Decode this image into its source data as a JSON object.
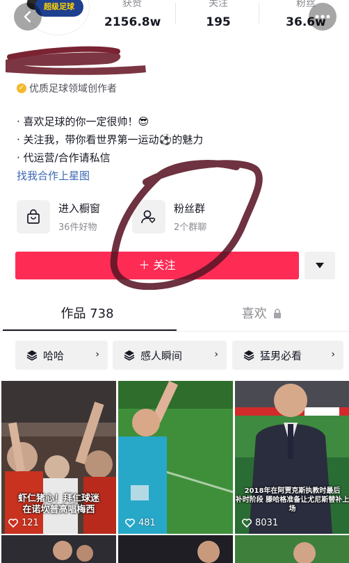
{
  "header": {
    "back_icon": "chevron-left-icon",
    "more_icon": "ellipsis-icon",
    "stats": [
      {
        "label": "获赞",
        "value": "2156.8w"
      },
      {
        "label": "关注",
        "value": "195"
      },
      {
        "label": "粉丝",
        "value": "36.6w"
      }
    ],
    "avatar_badge": "超级足球"
  },
  "profile": {
    "verified_label": "优质足球领域创作者",
    "bio": [
      "· 喜欢足球的你一定很帅！😎",
      "· 关注我，带你看世界第一运动⚽的魅力",
      "· 代运营/合作请私信"
    ],
    "star_link": "找我合作上星图"
  },
  "features": {
    "shop": {
      "title": "进入橱窗",
      "subtitle": "36件好物",
      "icon": "shopping-bag-icon"
    },
    "fans": {
      "title": "粉丝群",
      "subtitle": "2个群聊",
      "icon": "fan-group-icon"
    }
  },
  "actions": {
    "follow_label": "＋ 关注",
    "dropdown_icon": "triangle-down-icon"
  },
  "tabs": [
    {
      "label": "作品 738"
    },
    {
      "label": "喜欢"
    }
  ],
  "collections": [
    {
      "label": "哈哈"
    },
    {
      "label": "感人瞬间"
    },
    {
      "label": "猛男必看"
    }
  ],
  "videos": [
    {
      "likes": "121",
      "caption_line1": "虾仁猪心！拜仁球迷",
      "caption_line2": "在诺坎普高唱梅西"
    },
    {
      "likes": "481"
    },
    {
      "likes": "8031",
      "caption_line1": "2018年在阿贾克斯执教时最后",
      "caption_line2": "补时阶段 滕哈格准备让尤尼斯替补上场"
    }
  ],
  "colors": {
    "follow": "#fe2c55",
    "link": "#3a66b4",
    "verified": "#f5b72b"
  }
}
